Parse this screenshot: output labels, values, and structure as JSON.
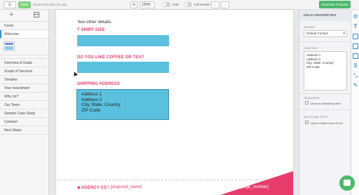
{
  "toolbar": {
    "save_label": "Save",
    "saved_status": "Saved less than 1m ago",
    "zoom": "120%",
    "grid_label": "Grid",
    "fullscreen_label": "Full Screen",
    "generate_label": "Generate Proposal"
  },
  "sidebar": {
    "items_top": [
      "Cover",
      "Welcome"
    ],
    "items_bottom": [
      "Overview & Goals",
      "Scope of Services",
      "Timeline",
      "Your Investment",
      "Why Us?",
      "Our Team",
      "Sample Case Study",
      "Contract",
      "Next Steps"
    ]
  },
  "document": {
    "intro_text": "few other details.",
    "label_shirt": "T SHIRT SIZE",
    "label_coffee": "DO YOU LIKE COFFEE OR TEA?",
    "label_address": "SHIPPING ADDRESS",
    "address_lines": [
      "Address 1",
      "Address 2",
      "City, State, Country",
      "ZIP Code"
    ],
    "footer_logo": "AGENCY CO",
    "footer_proposal": "{proposal_name}",
    "footer_page": "{page_number}",
    "accent_color": "#e63c6b",
    "field_color": "#5bc0de"
  },
  "properties": {
    "title": "FIELD PROPERTIES",
    "signee_label": "SIGNEE",
    "signee_value": "Default Contact",
    "content_label": "CONTENT",
    "content_lines": [
      "Address 1",
      "Address 2",
      "City, State, Country",
      "ZIP Code"
    ],
    "required_label": "REQUIRED",
    "required_check": "Mark as Mandatory field",
    "multiline_label": "MULTILINE TEXT",
    "multiline_check": "Allow multiple lines of text"
  }
}
